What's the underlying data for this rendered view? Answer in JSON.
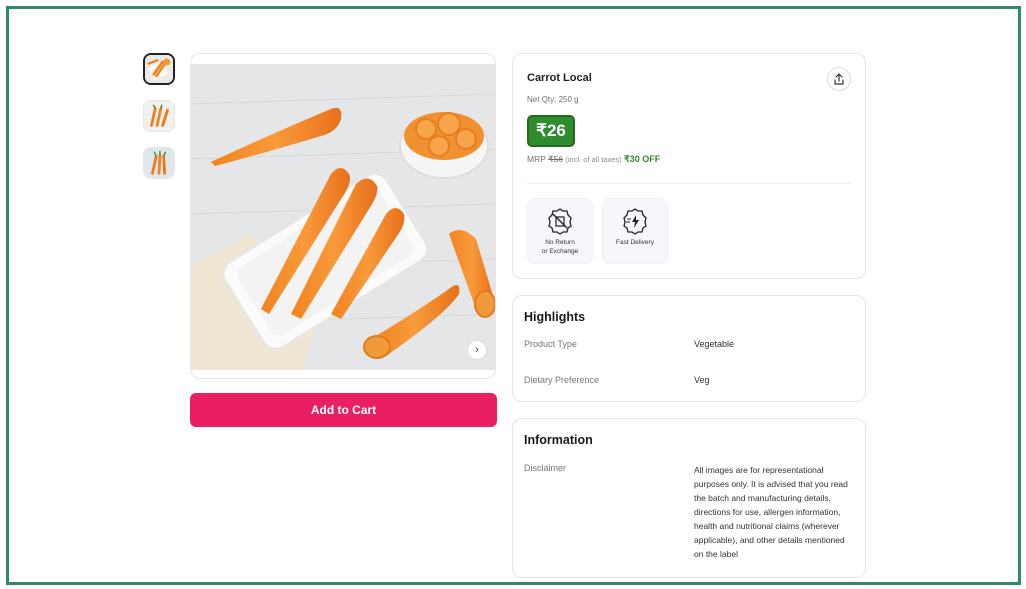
{
  "product": {
    "name": "Carrot Local",
    "net_qty": "Net Qty: 250 g",
    "price": "₹26",
    "mrp_label": "MRP",
    "mrp_value": "₹56",
    "tax_note": "(incl. of all taxes)",
    "discount": "₹30 OFF"
  },
  "gallery": {
    "thumbnail_count": 3,
    "active_index": 0
  },
  "features": [
    {
      "icon": "no-return-icon",
      "label_line1": "No Return",
      "label_line2": "or Exchange"
    },
    {
      "icon": "fast-delivery-icon",
      "label_line1": "Fast Delivery",
      "label_line2": ""
    }
  ],
  "actions": {
    "add_to_cart": "Add to Cart"
  },
  "highlights": {
    "title": "Highlights",
    "rows": [
      {
        "key": "Product Type",
        "value": "Vegetable"
      },
      {
        "key": "Dietary Preference",
        "value": "Veg"
      }
    ]
  },
  "information": {
    "title": "Information",
    "rows": [
      {
        "key": "Disclaimer",
        "value": "All images are for representational purposes only. It is advised that you read the batch and manufacturing details, directions for use, allergen information, health and nutritional claims (wherever applicable), and other details mentioned on the label"
      }
    ]
  },
  "colors": {
    "frame_border": "#2e8b65",
    "cta": "#e91e63",
    "price_badge": "#2e8b2e",
    "discount_text": "#2e8b2e"
  }
}
